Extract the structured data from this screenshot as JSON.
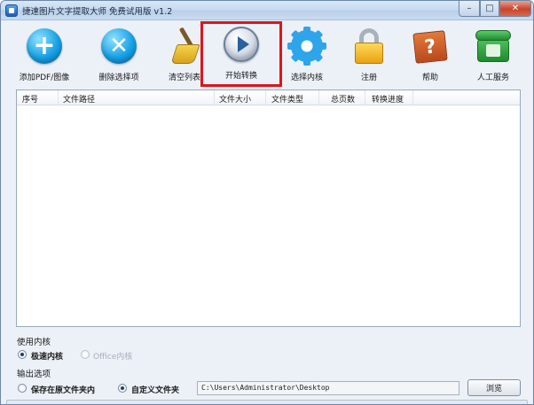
{
  "window": {
    "title": "捷速图片文字提取大师 免费试用版 v1.2",
    "controls": {
      "minimize": "–",
      "maximize": "□",
      "close": "✕"
    }
  },
  "toolbar": {
    "buttons": [
      {
        "label": "添加PDF/图像",
        "icon": "add-icon",
        "color": "#18a3e6"
      },
      {
        "label": "删除选择项",
        "icon": "delete-icon",
        "color": "#18a3e6"
      },
      {
        "label": "清空列表",
        "icon": "broom-icon",
        "color": "#f5d34a"
      },
      {
        "label": "开始转换",
        "icon": "play-icon",
        "color": "#2b5f9e",
        "highlighted": true,
        "highlight_color": "#e0141b"
      },
      {
        "label": "选择内核",
        "icon": "gear-icon",
        "color": "#2ea4ea"
      },
      {
        "label": "注册",
        "icon": "lock-icon",
        "color": "#e9a312"
      },
      {
        "label": "帮助",
        "icon": "help-book-icon",
        "color": "#c85a22"
      },
      {
        "label": "人工服务",
        "icon": "phone-icon",
        "color": "#1e8a2f"
      }
    ]
  },
  "file_list": {
    "columns": [
      "序号",
      "文件路径",
      "文件大小",
      "文件类型",
      "总页数",
      "转换进度"
    ],
    "rows": []
  },
  "engine": {
    "section_title": "使用内核",
    "options": [
      {
        "label": "极速内核",
        "selected": true,
        "enabled": true
      },
      {
        "label": "Office内核",
        "selected": false,
        "enabled": false
      }
    ]
  },
  "output": {
    "section_title": "输出选项",
    "options": [
      {
        "label": "保存在原文件夹内",
        "selected": false
      },
      {
        "label": "自定义文件夹",
        "selected": true
      }
    ],
    "path": "C:\\Users\\Administrator\\Desktop",
    "browse_label": "浏览"
  }
}
